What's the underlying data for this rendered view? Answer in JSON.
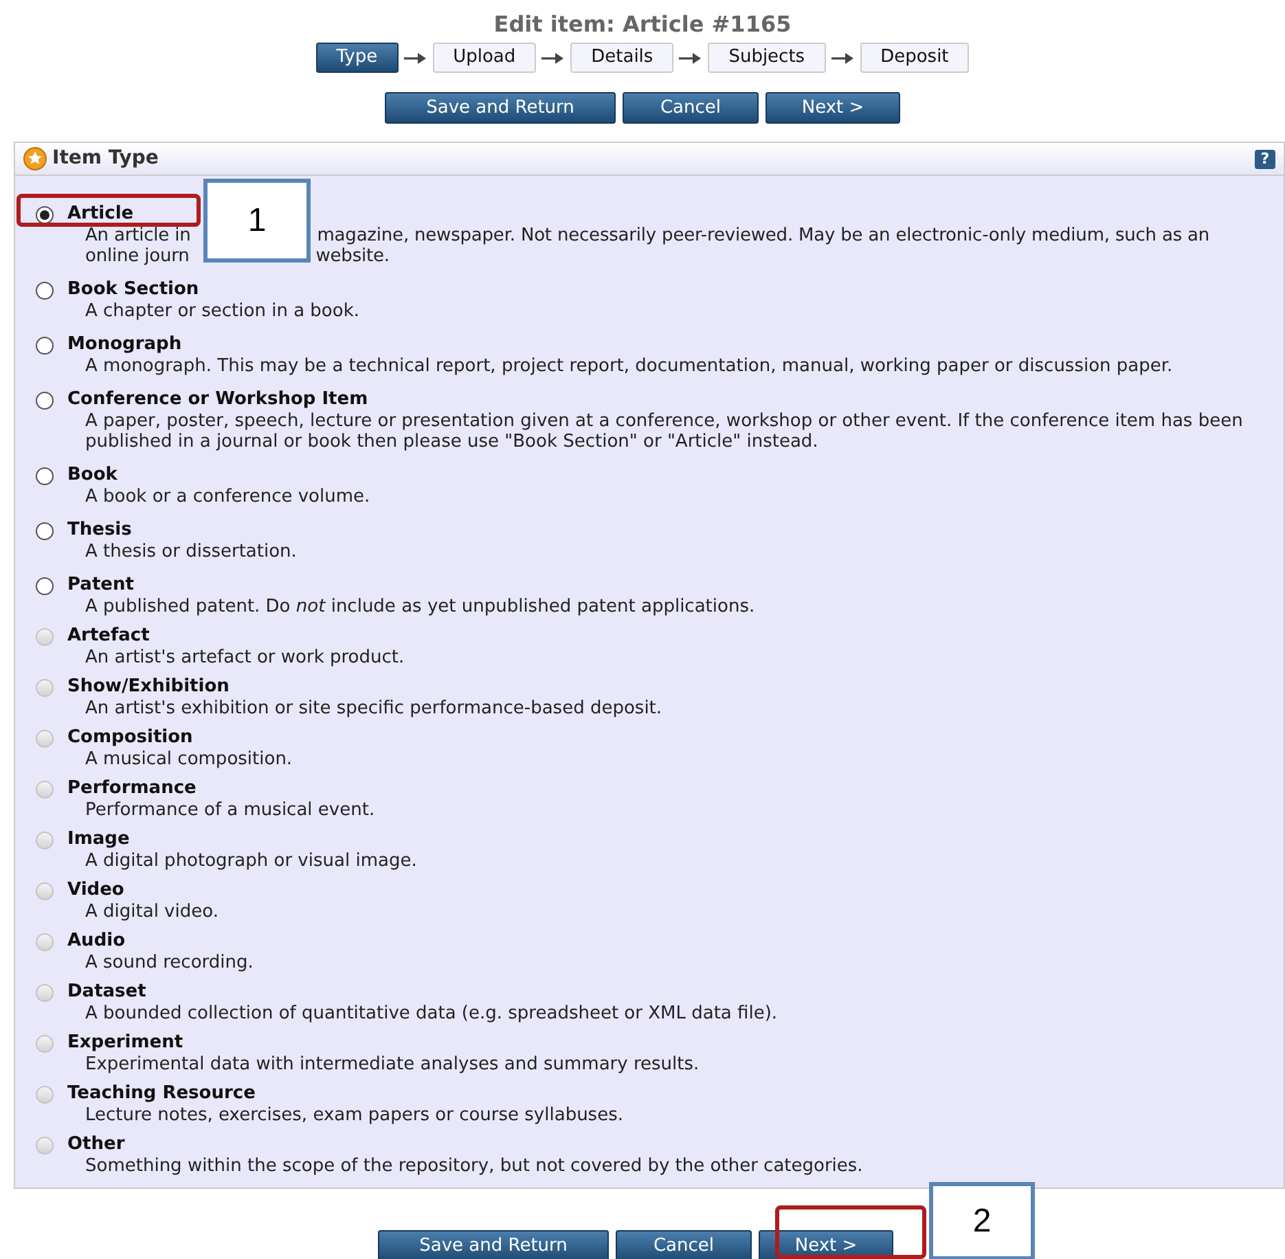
{
  "title": "Edit item: Article #1165",
  "steps": [
    {
      "label": "Type",
      "selected": true
    },
    {
      "label": "Upload",
      "selected": false
    },
    {
      "label": "Details",
      "selected": false
    },
    {
      "label": "Subjects",
      "selected": false
    },
    {
      "label": "Deposit",
      "selected": false
    }
  ],
  "top_buttons": [
    "Save and Return",
    "Cancel",
    "Next >"
  ],
  "panel": {
    "title": "Item Type",
    "help": "?",
    "items": [
      {
        "label": "Article",
        "selected": true,
        "disabled": false,
        "description_lines": [
          [
            "An article in",
            "magazine, newspaper. Not necessarily peer-reviewed. May be an electronic-only medium, such as an"
          ],
          [
            "online journ",
            "website."
          ]
        ]
      },
      {
        "label": "Book Section",
        "selected": false,
        "disabled": false,
        "description": "A chapter or section in a book."
      },
      {
        "label": "Monograph",
        "selected": false,
        "disabled": false,
        "description": "A monograph. This may be a technical report, project report, documentation, manual, working paper or discussion paper."
      },
      {
        "label": "Conference or Workshop Item",
        "selected": false,
        "disabled": false,
        "description": "A paper, poster, speech, lecture or presentation given at a conference, workshop or other event. If the conference item has been published in a journal or book then please use \"Book Section\" or \"Article\" instead."
      },
      {
        "label": "Book",
        "selected": false,
        "disabled": false,
        "description": "A book or a conference volume."
      },
      {
        "label": "Thesis",
        "selected": false,
        "disabled": false,
        "description": "A thesis or dissertation."
      },
      {
        "label": "Patent",
        "selected": false,
        "disabled": false,
        "description": "A published patent. Do *not* include as yet unpublished patent applications."
      },
      {
        "label": "Artefact",
        "selected": false,
        "disabled": true,
        "description": "An artist's artefact or work product."
      },
      {
        "label": "Show/Exhibition",
        "selected": false,
        "disabled": true,
        "description": "An artist's exhibition or site specific performance-based deposit."
      },
      {
        "label": "Composition",
        "selected": false,
        "disabled": true,
        "description": "A musical composition."
      },
      {
        "label": "Performance",
        "selected": false,
        "disabled": true,
        "description": "Performance of a musical event."
      },
      {
        "label": "Image",
        "selected": false,
        "disabled": true,
        "description": "A digital photograph or visual image."
      },
      {
        "label": "Video",
        "selected": false,
        "disabled": true,
        "description": "A digital video."
      },
      {
        "label": "Audio",
        "selected": false,
        "disabled": true,
        "description": "A sound recording."
      },
      {
        "label": "Dataset",
        "selected": false,
        "disabled": true,
        "description": "A bounded collection of quantitative data (e.g. spreadsheet or XML data file)."
      },
      {
        "label": "Experiment",
        "selected": false,
        "disabled": true,
        "description": "Experimental data with intermediate analyses and summary results."
      },
      {
        "label": "Teaching Resource",
        "selected": false,
        "disabled": true,
        "description": "Lecture notes, exercises, exam papers or course syllabuses."
      },
      {
        "label": "Other",
        "selected": false,
        "disabled": true,
        "description": "Something within the scope of the repository, but not covered by the other categories."
      }
    ]
  },
  "bottom_buttons": [
    "Save and Return",
    "Cancel",
    "Next >"
  ],
  "callouts": [
    {
      "text": "1",
      "highlight": true
    },
    {
      "text": "2",
      "highlight": true
    }
  ]
}
